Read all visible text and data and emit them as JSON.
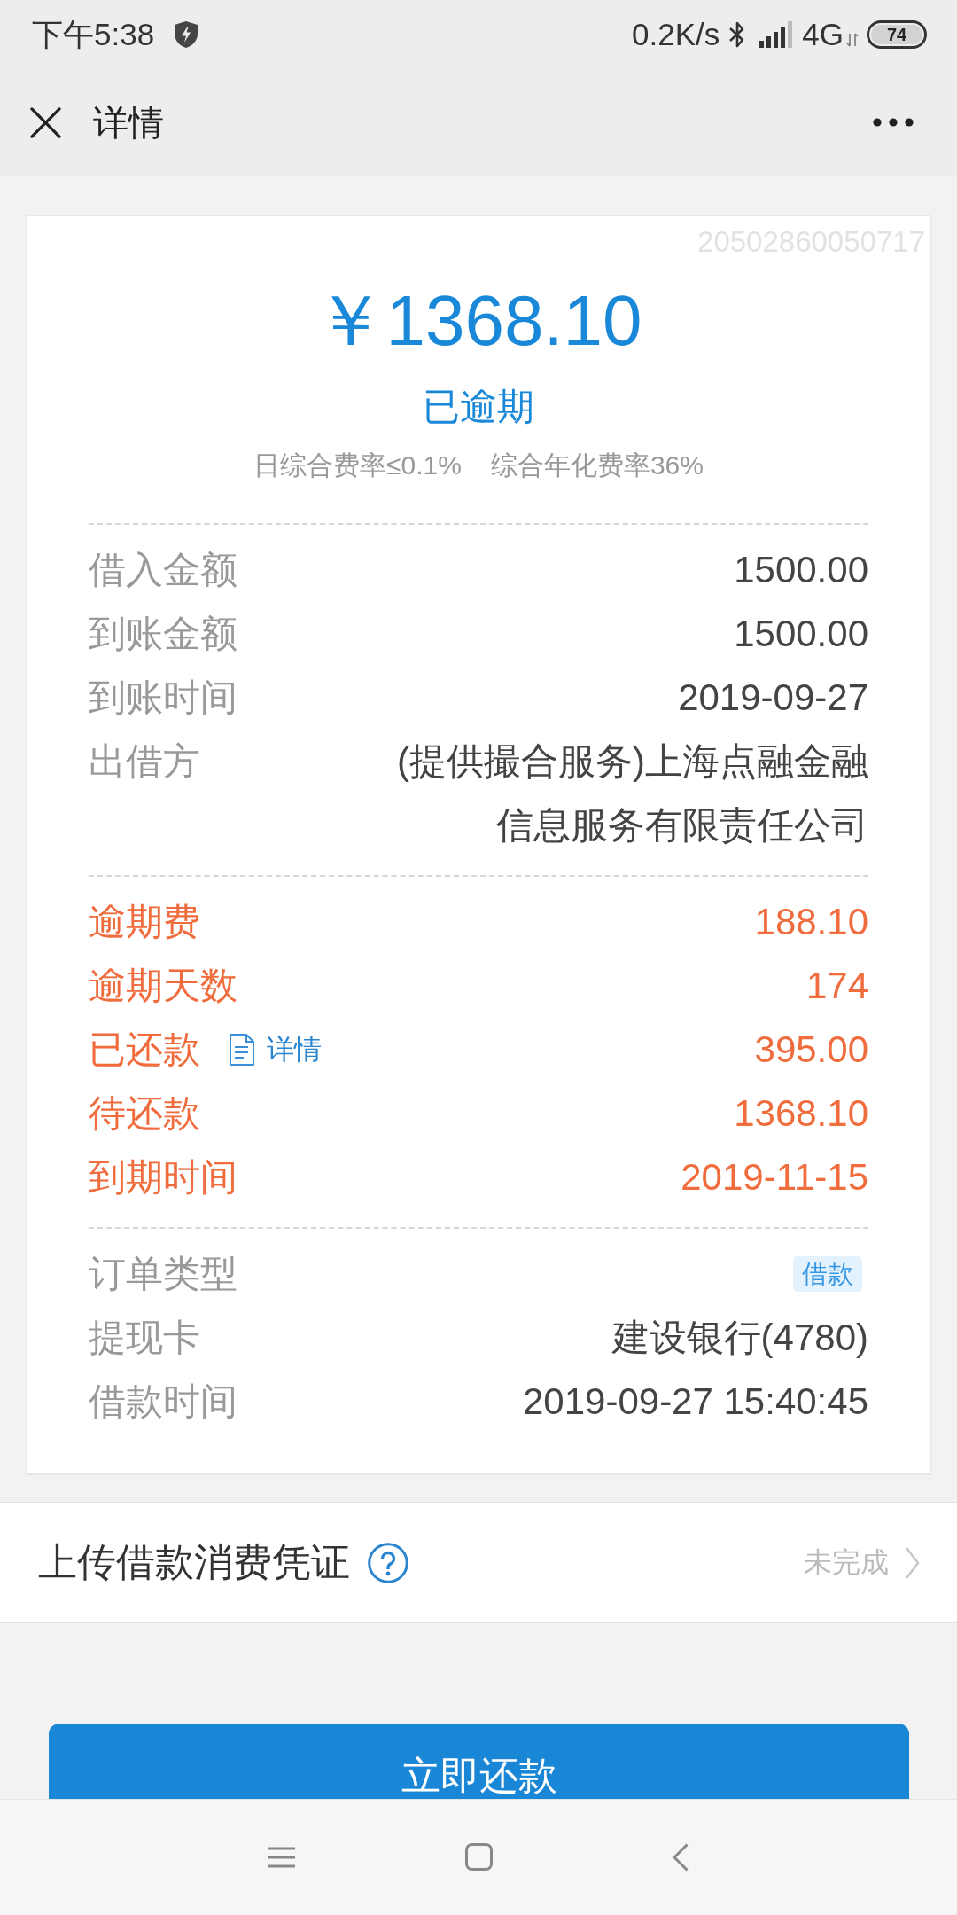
{
  "status_bar": {
    "time": "下午5:38",
    "network_speed": "0.2K/s",
    "network_type": "4G",
    "battery": "74"
  },
  "header": {
    "title": "详情"
  },
  "summary": {
    "order_number": "20502860050717",
    "amount": "￥1368.10",
    "status": "已逾期",
    "rates": [
      "日综合费率≤0.1%",
      "综合年化费率36%"
    ]
  },
  "sections": [
    {
      "overdue": false,
      "rows": [
        {
          "kind": "text",
          "label": "借入金额",
          "value": "1500.00"
        },
        {
          "kind": "text",
          "label": "到账金额",
          "value": "1500.00"
        },
        {
          "kind": "text",
          "label": "到账时间",
          "value": "2019-09-27"
        },
        {
          "kind": "text",
          "label": "出借方",
          "value": "(提供撮合服务)上海点融金融信息服务有限责任公司"
        }
      ]
    },
    {
      "overdue": true,
      "rows": [
        {
          "kind": "text",
          "label": "逾期费",
          "value": "188.10"
        },
        {
          "kind": "text",
          "label": "逾期天数",
          "value": "174"
        },
        {
          "kind": "text",
          "label": "已还款",
          "link": "详情",
          "value": "395.00"
        },
        {
          "kind": "text",
          "label": "待还款",
          "value": "1368.10"
        },
        {
          "kind": "text",
          "label": "到期时间",
          "value": "2019-11-15"
        }
      ]
    },
    {
      "overdue": false,
      "rows": [
        {
          "kind": "tag",
          "label": "订单类型",
          "value": "借款"
        },
        {
          "kind": "text",
          "label": "提现卡",
          "value": "建设银行(4780)"
        },
        {
          "kind": "text",
          "label": "借款时间",
          "value": "2019-09-27 15:40:45"
        }
      ]
    }
  ],
  "voucher": {
    "title": "上传借款消费凭证",
    "status": "未完成"
  },
  "primary_button": {
    "label": "立即还款"
  }
}
